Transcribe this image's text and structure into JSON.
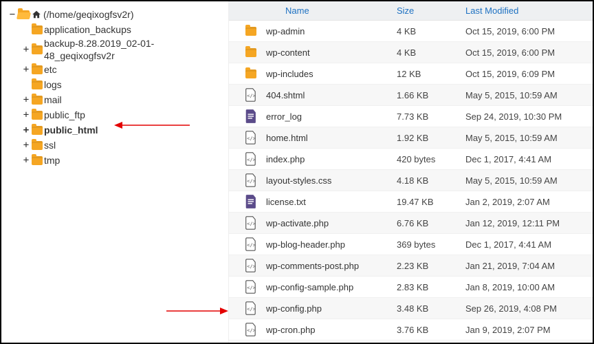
{
  "tree": {
    "rootLabel": "(/home/geqixogfsv2r)",
    "items": [
      {
        "label": "application_backups",
        "expandable": false
      },
      {
        "label": "backup-8.28.2019_02-01-48_geqixogfsv2r",
        "expandable": true,
        "wrap": true
      },
      {
        "label": "etc",
        "expandable": true
      },
      {
        "label": "logs",
        "expandable": false
      },
      {
        "label": "mail",
        "expandable": true
      },
      {
        "label": "public_ftp",
        "expandable": true
      },
      {
        "label": "public_html",
        "expandable": true,
        "bold": true
      },
      {
        "label": "ssl",
        "expandable": true
      },
      {
        "label": "tmp",
        "expandable": true
      }
    ]
  },
  "headers": {
    "name": "Name",
    "size": "Size",
    "modified": "Last Modified"
  },
  "files": [
    {
      "icon": "folder",
      "name": "wp-admin",
      "size": "4 KB",
      "modified": "Oct 15, 2019, 6:00 PM"
    },
    {
      "icon": "folder",
      "name": "wp-content",
      "size": "4 KB",
      "modified": "Oct 15, 2019, 6:00 PM"
    },
    {
      "icon": "folder",
      "name": "wp-includes",
      "size": "12 KB",
      "modified": "Oct 15, 2019, 6:09 PM"
    },
    {
      "icon": "code",
      "name": "404.shtml",
      "size": "1.66 KB",
      "modified": "May 5, 2015, 10:59 AM"
    },
    {
      "icon": "text",
      "name": "error_log",
      "size": "7.73 KB",
      "modified": "Sep 24, 2019, 10:30 PM"
    },
    {
      "icon": "code",
      "name": "home.html",
      "size": "1.92 KB",
      "modified": "May 5, 2015, 10:59 AM"
    },
    {
      "icon": "code",
      "name": "index.php",
      "size": "420 bytes",
      "modified": "Dec 1, 2017, 4:41 AM"
    },
    {
      "icon": "code",
      "name": "layout-styles.css",
      "size": "4.18 KB",
      "modified": "May 5, 2015, 10:59 AM"
    },
    {
      "icon": "text",
      "name": "license.txt",
      "size": "19.47 KB",
      "modified": "Jan 2, 2019, 2:07 AM"
    },
    {
      "icon": "code",
      "name": "wp-activate.php",
      "size": "6.76 KB",
      "modified": "Jan 12, 2019, 12:11 PM"
    },
    {
      "icon": "code",
      "name": "wp-blog-header.php",
      "size": "369 bytes",
      "modified": "Dec 1, 2017, 4:41 AM"
    },
    {
      "icon": "code",
      "name": "wp-comments-post.php",
      "size": "2.23 KB",
      "modified": "Jan 21, 2019, 7:04 AM"
    },
    {
      "icon": "code",
      "name": "wp-config-sample.php",
      "size": "2.83 KB",
      "modified": "Jan 8, 2019, 10:00 AM"
    },
    {
      "icon": "code",
      "name": "wp-config.php",
      "size": "3.48 KB",
      "modified": "Sep 26, 2019, 4:08 PM"
    },
    {
      "icon": "code",
      "name": "wp-cron.php",
      "size": "3.76 KB",
      "modified": "Jan 9, 2019, 2:07 PM"
    }
  ]
}
